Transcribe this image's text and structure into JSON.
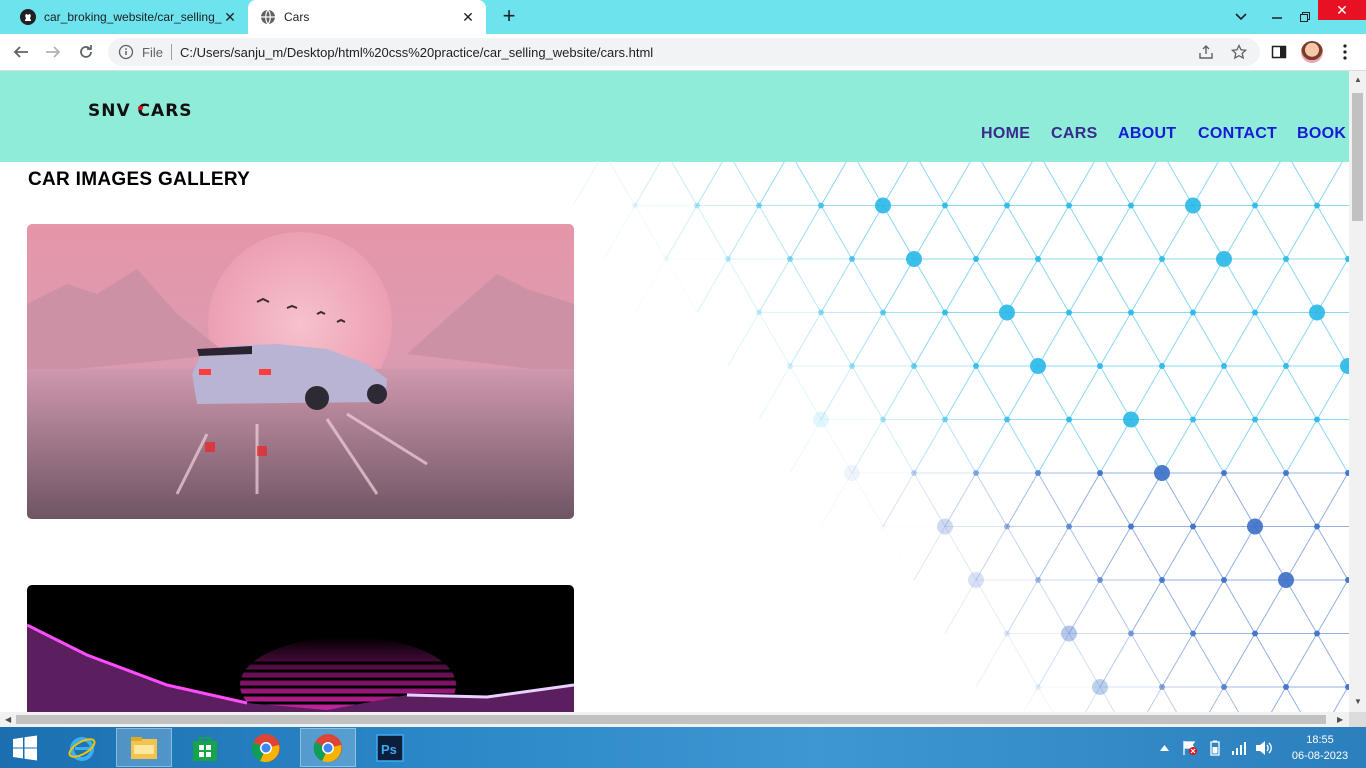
{
  "browser": {
    "tabs": [
      {
        "title": "car_broking_website/car_selling_",
        "icon": "github-icon",
        "active": false
      },
      {
        "title": "Cars",
        "icon": "globe-icon",
        "active": true
      }
    ],
    "address": {
      "scheme_label": "File",
      "url": "C:/Users/sanju_m/Desktop/html%20css%20practice/car_selling_website/cars.html"
    }
  },
  "site": {
    "logo": {
      "before": "SNV ",
      "c": "C",
      "after": "ARS"
    },
    "nav": [
      {
        "label": "HOME",
        "color": "#3a2a8c"
      },
      {
        "label": "CARS",
        "color": "#3a2a8c"
      },
      {
        "label": "ABOUT",
        "color": "#1a1ad6"
      },
      {
        "label": "CONTACT",
        "color": "#1a1ad6"
      },
      {
        "label": "BOOK",
        "color": "#1a1ad6"
      }
    ],
    "gallery_title": "CAR IMAGES GALLERY",
    "header_color": "#8eecd8"
  },
  "taskbar": {
    "apps": [
      "windows-start-icon",
      "internet-explorer-icon",
      "file-explorer-icon",
      "windows-store-icon",
      "chrome-icon",
      "chrome-icon",
      "photoshop-icon"
    ],
    "clock": {
      "time": "18:55",
      "date": "06-08-2023"
    }
  }
}
